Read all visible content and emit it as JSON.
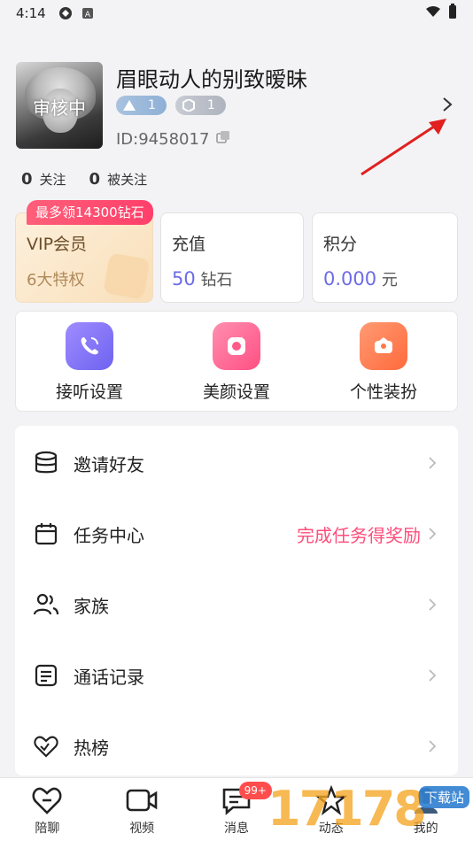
{
  "status_bar": {
    "time": "4:14"
  },
  "profile": {
    "avatar_status": "审核中",
    "nickname": "眉眼动人的别致暧昧",
    "badges": [
      {
        "value": "1"
      },
      {
        "value": "1"
      }
    ],
    "id_text": "ID:9458017"
  },
  "follows": {
    "following_count": "0",
    "following_label": "关注",
    "followers_count": "0",
    "followers_label": "被关注"
  },
  "cards": {
    "vip": {
      "ribbon": "最多领14300钻石",
      "title": "VIP会员",
      "sub": "6大特权"
    },
    "recharge": {
      "title": "充值",
      "amount": "50",
      "unit": "钻石"
    },
    "points": {
      "title": "积分",
      "amount": "0.000",
      "unit": "元"
    }
  },
  "shortcuts": [
    {
      "label": "接听设置",
      "icon": "phone-call-icon"
    },
    {
      "label": "美颜设置",
      "icon": "beauty-icon"
    },
    {
      "label": "个性装扮",
      "icon": "dress-up-icon"
    }
  ],
  "menu": [
    {
      "label": "邀请好友",
      "icon": "coins-stack-icon",
      "extra": ""
    },
    {
      "label": "任务中心",
      "icon": "calendar-icon",
      "extra": "完成任务得奖励"
    },
    {
      "label": "家族",
      "icon": "users-icon",
      "extra": ""
    },
    {
      "label": "通话记录",
      "icon": "document-icon",
      "extra": ""
    },
    {
      "label": "热榜",
      "icon": "heart-icon",
      "extra": ""
    }
  ],
  "tabbar": {
    "tabs": [
      {
        "label": "陪聊",
        "icon": "heart-chat-icon"
      },
      {
        "label": "视频",
        "icon": "video-icon"
      },
      {
        "label": "消息",
        "icon": "message-icon",
        "badge": "99+"
      },
      {
        "label": "动态",
        "icon": "star-icon"
      },
      {
        "label": "我的",
        "icon": "profile-icon"
      }
    ]
  },
  "watermark": {
    "text": "17178",
    "tag": "下载站"
  },
  "colors": {
    "accent": "#6d6ce8",
    "pink": "#ff4d7a",
    "vip_bg": "#fdf0dc"
  }
}
